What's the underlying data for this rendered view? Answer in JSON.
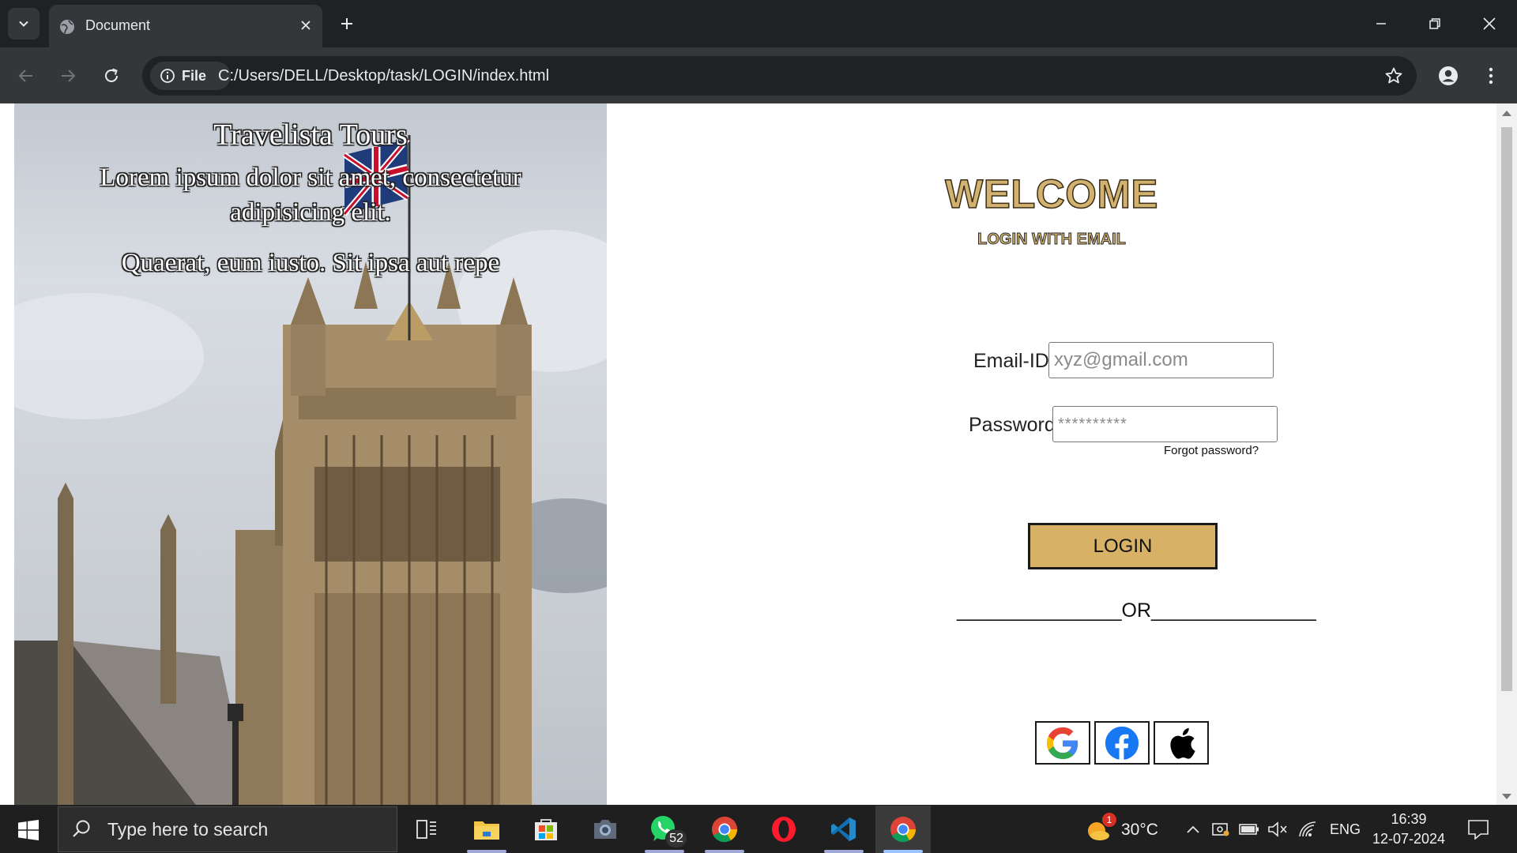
{
  "browser": {
    "tab_title": "Document",
    "site_chip_label": "File",
    "url": "C:/Users/DELL/Desktop/task/LOGIN/index.html"
  },
  "hero": {
    "title": "Travelista Tours",
    "subtitle_line1": "Lorem ipsum dolor sit amet, consectetur adipisicing elit.",
    "subtitle_line2": "Quaerat, eum iusto. Sit ipsa aut repe"
  },
  "login": {
    "welcome": "WELCOME",
    "subheading": "LOGIN WITH EMAIL",
    "email_label": "Email-ID",
    "email_placeholder": "xyz@gmail.com",
    "password_label": "Password",
    "password_placeholder": "**********",
    "forgot_password": "Forgot password?",
    "login_button": "LOGIN",
    "or_divider": "_______________OR_______________",
    "social_buttons": [
      "google-icon",
      "facebook-icon",
      "apple-icon"
    ]
  },
  "taskbar": {
    "search_placeholder": "Type here to search",
    "whatsapp_badge": "52",
    "weather_badge": "1",
    "temperature": "30°C",
    "language": "ENG",
    "time": "16:39",
    "date": "12-07-2024"
  },
  "colors": {
    "accent_gold": "#d6b166",
    "chrome_dark": "#202124",
    "chrome_mid": "#35363a"
  }
}
